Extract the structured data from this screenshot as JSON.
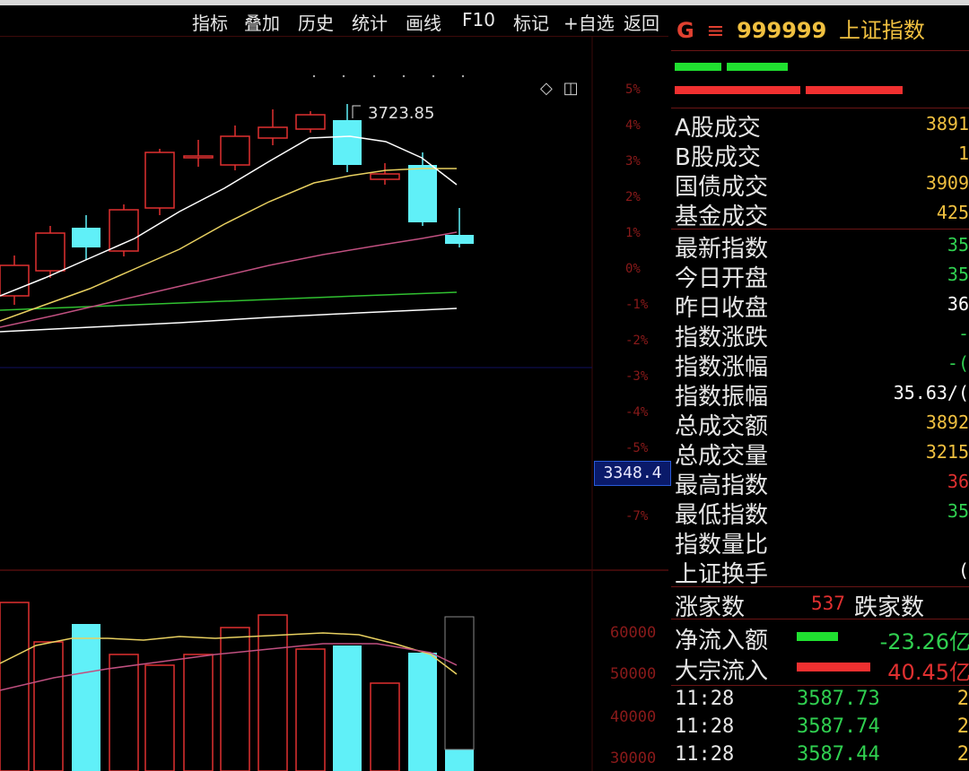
{
  "menu": [
    "指标",
    "叠加",
    "历史",
    "统计",
    "画线",
    "F10",
    "标记",
    "+自选",
    "返回"
  ],
  "chart": {
    "high_label": "3723.85",
    "current_price_tag": "3348.4",
    "pct_ticks": [
      "5%",
      "4%",
      "3%",
      "2%",
      "1%",
      "0%",
      "-1%",
      "-2%",
      "-3%",
      "-4%",
      "-5%",
      "-7%"
    ],
    "volume_ticks": [
      "60000",
      "50000",
      "40000",
      "30000"
    ],
    "colors": {
      "up": "#e03030",
      "down": "#60f0f8",
      "ma5": "#ffffff",
      "ma10": "#e8d060",
      "ma20": "#c05080",
      "ma60": "#30c030"
    }
  },
  "panel": {
    "market_letter": "G",
    "menu_icon": "≡",
    "code": "999999",
    "name": "上证指数",
    "rows": [
      {
        "label": "A股成交",
        "value": "3891",
        "color": "#f0c040"
      },
      {
        "label": "B股成交",
        "value": "1",
        "color": "#f0c040"
      },
      {
        "label": "国债成交",
        "value": "3909",
        "color": "#f0c040"
      },
      {
        "label": "基金成交",
        "value": "425",
        "color": "#f0c040"
      },
      {
        "label": "最新指数",
        "value": "35",
        "color": "#30d050"
      },
      {
        "label": "今日开盘",
        "value": "35",
        "color": "#30d050"
      },
      {
        "label": "昨日收盘",
        "value": "36",
        "color": "#ffffff"
      },
      {
        "label": "指数涨跌",
        "value": "-",
        "color": "#30d050"
      },
      {
        "label": "指数涨幅",
        "value": "-(",
        "color": "#30d050"
      },
      {
        "label": "指数振幅",
        "value": "35.63/(",
        "color": "#ffffff"
      },
      {
        "label": "总成交额",
        "value": "3892",
        "color": "#f0c040"
      },
      {
        "label": "总成交量",
        "value": "3215",
        "color": "#f0c040"
      },
      {
        "label": "最高指数",
        "value": "36",
        "color": "#e03030"
      },
      {
        "label": "最低指数",
        "value": "35",
        "color": "#30d050"
      },
      {
        "label": "指数量比",
        "value": "",
        "color": "#ffffff"
      },
      {
        "label": "上证换手",
        "value": "(",
        "color": "#ffffff"
      }
    ],
    "rise_label": "涨家数",
    "rise_count": "537",
    "fall_label": "跌家数",
    "flows": [
      {
        "label": "净流入额",
        "value": "-23.26亿",
        "color": "#30d050",
        "bar": "#20e030"
      },
      {
        "label": "大宗流入",
        "value": "40.45亿",
        "color": "#e03030",
        "bar": "#f03030"
      }
    ],
    "ticks": [
      {
        "time": "11:28",
        "price": "3587.73",
        "vol": "2"
      },
      {
        "time": "11:28",
        "price": "3587.74",
        "vol": "2"
      },
      {
        "time": "11:28",
        "price": "3587.44",
        "vol": "2"
      }
    ]
  }
}
